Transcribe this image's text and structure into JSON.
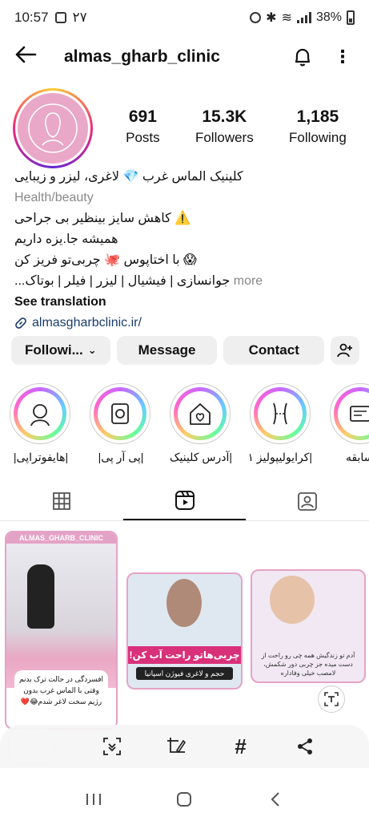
{
  "status_bar": {
    "time": "10:57",
    "extra": "۲۷",
    "battery": "38%",
    "network": "LTE1"
  },
  "header": {
    "username": "almas_gharb_clinic"
  },
  "profile": {
    "posts_count": "691",
    "posts_label": "Posts",
    "followers_count": "15.3K",
    "followers_label": "Followers",
    "following_count": "1,185",
    "following_label": "Following"
  },
  "bio": {
    "name_line": "کلینیک الماس غرب 💎 لاغری، لیزر و زیبایی",
    "category": "Health/beauty",
    "line1": "⚠️ کاهش سایز بینظیر بی جراحی",
    "line2": "همیشه جا.یزه داریم",
    "line3": "😱 با اختاپوس 🐙 چربی‌تو فریز کن",
    "line4": "جوانسازی | فیشیال | لیزر | فیلر | بوتاک...",
    "more": "more",
    "see_translation": "See translation",
    "website": "almasgharbclinic.ir/"
  },
  "buttons": {
    "following": "Followi...",
    "message": "Message",
    "contact": "Contact"
  },
  "highlights": [
    {
      "label": "|هایفوتراپی|",
      "icon": "face-icon"
    },
    {
      "label": "|پی آر پی|",
      "icon": "device-icon"
    },
    {
      "label": "|آدرس کلینیک|",
      "icon": "home-heart-icon"
    },
    {
      "label": "|کرایولیپولیز ۱|",
      "icon": "waist-icon"
    },
    {
      "label": "|سابقه",
      "icon": "certificate-icon"
    }
  ],
  "grid": {
    "post1_brand": "ALMAS_GHARB_CLINIC",
    "post1_caption": "افسردگی در حالت ترک بدنم وقتی با الماس غرب بدون رژیم سخت لاغر شدم😂❤️",
    "post2_band": "چربی‌هاتو راحت آب کن!",
    "post2_sub": "حجم و لاغری فیوژن اسپانیا",
    "post3_text": "آدم تو زندگیش همه چی رو راحت از دست میده جز چربی دور شکمش، لامصب خیلی وفاداره"
  },
  "colors": {
    "accent": "#e4a3c6",
    "link": "#1a3c6e",
    "button_bg": "#efefef"
  }
}
